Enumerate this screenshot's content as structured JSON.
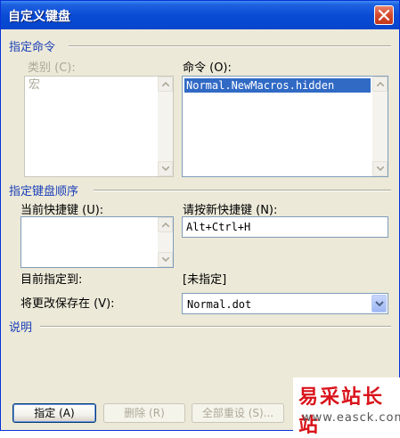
{
  "window": {
    "title": "自定义键盘"
  },
  "specify_command": {
    "group_label": "指定命令",
    "categories_label": "类别 (C):",
    "categories_items": [
      "宏"
    ],
    "commands_label": "命令 (O):",
    "commands_items": [
      "Normal.NewMacros.hidden"
    ]
  },
  "key_sequence": {
    "group_label": "指定键盘顺序",
    "current_keys_label": "当前快捷键 (U):",
    "current_keys_items": [],
    "new_key_label": "请按新快捷键 (N):",
    "new_key_value": "Alt+Ctrl+H",
    "assigned_to_label": "目前指定到:",
    "assigned_to_value": "[未指定]",
    "save_in_label": "将更改保存在 (V):",
    "save_in_value": "Normal.dot"
  },
  "description": {
    "group_label": "说明"
  },
  "buttons": {
    "assign": "指定 (A)",
    "remove": "删除 (R)",
    "reset_all": "全部重设 (S)..."
  },
  "watermark": {
    "brand": "易采站长站",
    "url": "www.easck.com"
  },
  "colors": {
    "title_bar": "#0a4cd4",
    "group_label": "#1a3fb8",
    "selection": "#316ac5",
    "watermark": "#d9131a"
  }
}
